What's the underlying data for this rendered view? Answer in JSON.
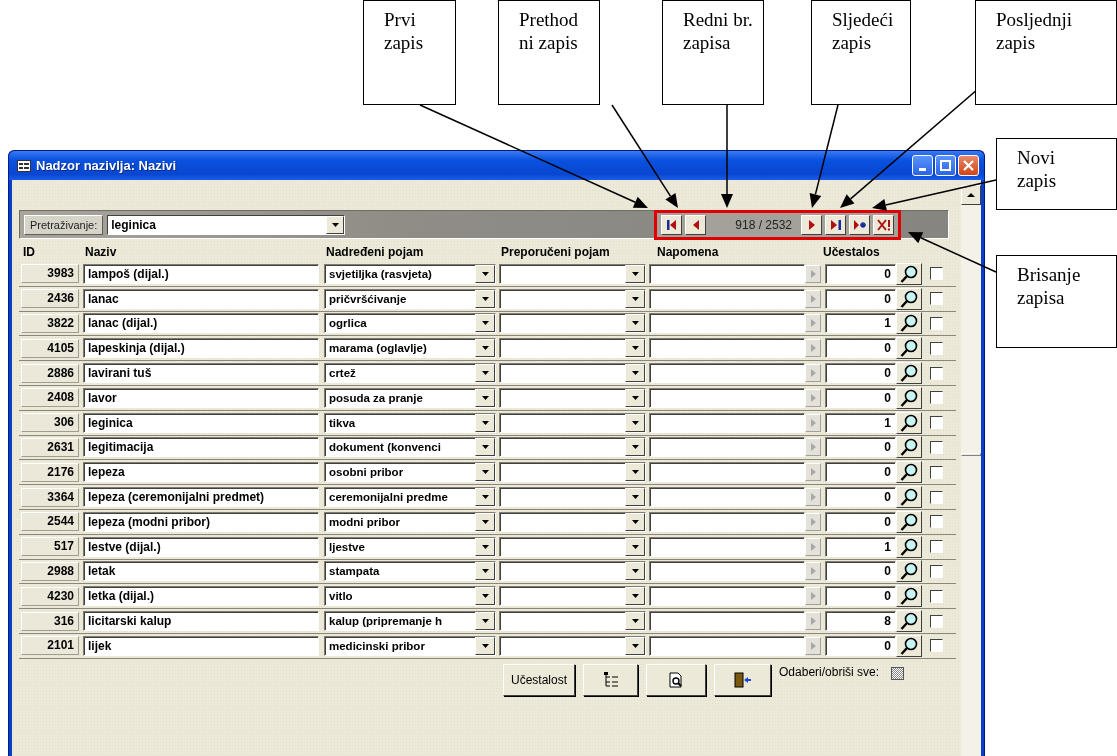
{
  "callouts": [
    {
      "text": "Prvi zapis"
    },
    {
      "text": "Prethodni zapis"
    },
    {
      "text": "Redni br. zapisa"
    },
    {
      "text": "Sljedeći zapis"
    },
    {
      "text": "Posljednji zapis"
    },
    {
      "text": "Novi zapis"
    },
    {
      "text": "Brisanje zapisa"
    }
  ],
  "window": {
    "title": "Nadzor nazivlja: Nazivi"
  },
  "search": {
    "label": "Pretraživanje:",
    "value": "leginica"
  },
  "navigator": {
    "position": "918 / 2532"
  },
  "columns": [
    "ID",
    "Naziv",
    "Nadređeni pojam",
    "Preporučeni pojam",
    "Napomena",
    "Učestalos"
  ],
  "rows": [
    {
      "id": "3983",
      "naziv": "lampoš (dijal.)",
      "nadredjeni": "svjetiljka (rasvjeta)",
      "count": "0",
      "checked": false
    },
    {
      "id": "2436",
      "naziv": "lanac",
      "nadredjeni": "pričvršćivanje",
      "count": "0",
      "checked": false
    },
    {
      "id": "3822",
      "naziv": "lanac (dijal.)",
      "nadredjeni": "ogrlica",
      "count": "1",
      "checked": false
    },
    {
      "id": "4105",
      "naziv": "lapeskinja (dijal.)",
      "nadredjeni": "marama (oglavlje)",
      "count": "0",
      "checked": false
    },
    {
      "id": "2886",
      "naziv": "lavirani tuš",
      "nadredjeni": "crtež",
      "count": "0",
      "checked": false
    },
    {
      "id": "2408",
      "naziv": "lavor",
      "nadredjeni": "posuda za pranje",
      "count": "0",
      "checked": false
    },
    {
      "id": "306",
      "naziv": "leginica",
      "nadredjeni": "tikva",
      "count": "1",
      "checked": false
    },
    {
      "id": "2631",
      "naziv": "legitimacija",
      "nadredjeni": "dokument (konvenci",
      "count": "0",
      "checked": false
    },
    {
      "id": "2176",
      "naziv": "lepeza",
      "nadredjeni": "osobni pribor",
      "count": "0",
      "checked": false
    },
    {
      "id": "3364",
      "naziv": "lepeza (ceremonijalni predmet)",
      "nadredjeni": "ceremonijalni predme",
      "count": "0",
      "checked": false
    },
    {
      "id": "2544",
      "naziv": "lepeza (modni pribor)",
      "nadredjeni": "modni pribor",
      "count": "0",
      "checked": false
    },
    {
      "id": "517",
      "naziv": "lestve (dijal.)",
      "nadredjeni": "ljestve",
      "count": "1",
      "checked": false
    },
    {
      "id": "2988",
      "naziv": "letak",
      "nadredjeni": "stampata",
      "count": "0",
      "checked": false
    },
    {
      "id": "4230",
      "naziv": "letka (dijal.)",
      "nadredjeni": "vitlo",
      "count": "0",
      "checked": false
    },
    {
      "id": "316",
      "naziv": "licitarski kalup",
      "nadredjeni": "kalup (pripremanje h",
      "count": "8",
      "checked": false
    },
    {
      "id": "2101",
      "naziv": "lijek",
      "nadredjeni": "medicinski pribor",
      "count": "0",
      "checked": false
    }
  ],
  "footer": {
    "buttons": [
      {
        "kind": "text",
        "label": "Učestalost"
      },
      {
        "kind": "tree"
      },
      {
        "kind": "preview"
      },
      {
        "kind": "exit"
      }
    ],
    "select_all_label": "Odaberi/obriši sve:",
    "select_all_disabled": true
  }
}
